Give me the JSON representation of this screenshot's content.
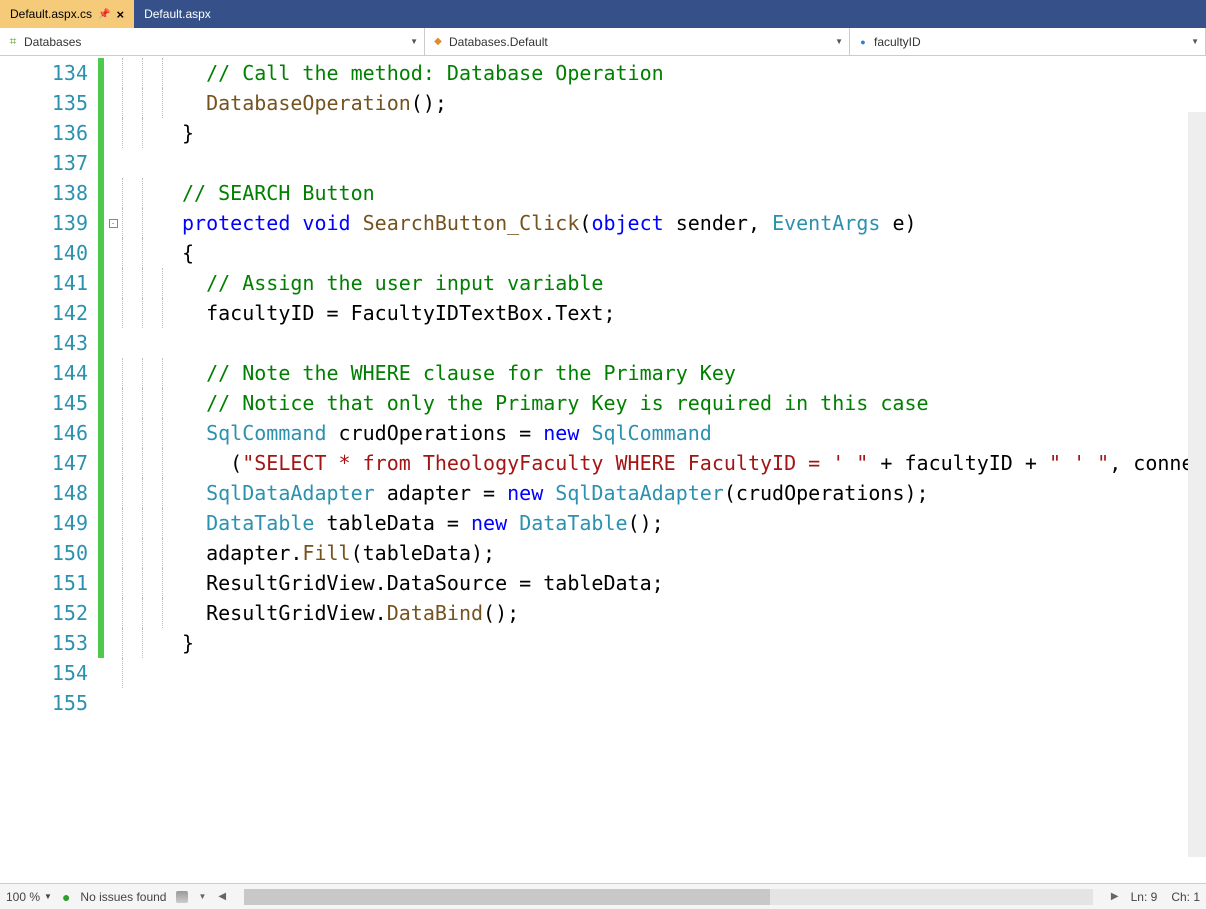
{
  "tabs": [
    {
      "label": "Default.aspx.cs",
      "active": true,
      "has_pin": true,
      "has_close": true
    },
    {
      "label": "Default.aspx",
      "active": false,
      "has_pin": false,
      "has_close": false
    }
  ],
  "crumbs": {
    "scope": "Databases",
    "class": "Databases.Default",
    "member": "facultyID"
  },
  "line_start": 134,
  "line_end": 155,
  "modified_lines_green_start": 134,
  "modified_lines_green_end": 153,
  "fold_line": 139,
  "code_lines": [
    {
      "n": 134,
      "indent": 3,
      "tokens": [
        {
          "t": "// Call the method: Database Operation",
          "c": "comment"
        }
      ]
    },
    {
      "n": 135,
      "indent": 3,
      "tokens": [
        {
          "t": "DatabaseOperation",
          "c": "method"
        },
        {
          "t": "();",
          "c": "text"
        }
      ]
    },
    {
      "n": 136,
      "indent": 2,
      "tokens": [
        {
          "t": "}",
          "c": "text"
        }
      ]
    },
    {
      "n": 137,
      "indent": 0,
      "tokens": []
    },
    {
      "n": 138,
      "indent": 2,
      "tokens": [
        {
          "t": "// SEARCH Button",
          "c": "comment"
        }
      ]
    },
    {
      "n": 139,
      "indent": 2,
      "tokens": [
        {
          "t": "protected",
          "c": "keyword"
        },
        {
          "t": " ",
          "c": "text"
        },
        {
          "t": "void",
          "c": "keyword"
        },
        {
          "t": " ",
          "c": "text"
        },
        {
          "t": "SearchButton_Click",
          "c": "method"
        },
        {
          "t": "(",
          "c": "text"
        },
        {
          "t": "object",
          "c": "keyword"
        },
        {
          "t": " sender, ",
          "c": "text"
        },
        {
          "t": "EventArgs",
          "c": "type"
        },
        {
          "t": " e)",
          "c": "text"
        }
      ]
    },
    {
      "n": 140,
      "indent": 2,
      "tokens": [
        {
          "t": "{",
          "c": "text"
        }
      ]
    },
    {
      "n": 141,
      "indent": 3,
      "tokens": [
        {
          "t": "// Assign the user input variable",
          "c": "comment"
        }
      ]
    },
    {
      "n": 142,
      "indent": 3,
      "tokens": [
        {
          "t": "facultyID = FacultyIDTextBox.Text;",
          "c": "text"
        }
      ]
    },
    {
      "n": 143,
      "indent": 0,
      "tokens": []
    },
    {
      "n": 144,
      "indent": 3,
      "tokens": [
        {
          "t": "// Note the WHERE clause for the Primary Key",
          "c": "comment"
        }
      ]
    },
    {
      "n": 145,
      "indent": 3,
      "tokens": [
        {
          "t": "// Notice that only the Primary Key is required in this case",
          "c": "comment"
        }
      ]
    },
    {
      "n": 146,
      "indent": 3,
      "tokens": [
        {
          "t": "SqlCommand",
          "c": "type"
        },
        {
          "t": " crudOperations = ",
          "c": "text"
        },
        {
          "t": "new",
          "c": "keyword"
        },
        {
          "t": " ",
          "c": "text"
        },
        {
          "t": "SqlCommand",
          "c": "type"
        }
      ]
    },
    {
      "n": 147,
      "indent": 4,
      "tokens": [
        {
          "t": "(",
          "c": "text"
        },
        {
          "t": "\"SELECT * from TheologyFaculty WHERE FacultyID = ' \"",
          "c": "string"
        },
        {
          "t": " + facultyID + ",
          "c": "text"
        },
        {
          "t": "\" ' \"",
          "c": "string"
        },
        {
          "t": ", connectDatabase);",
          "c": "text"
        }
      ]
    },
    {
      "n": 148,
      "indent": 3,
      "tokens": [
        {
          "t": "SqlDataAdapter",
          "c": "type"
        },
        {
          "t": " adapter = ",
          "c": "text"
        },
        {
          "t": "new",
          "c": "keyword"
        },
        {
          "t": " ",
          "c": "text"
        },
        {
          "t": "SqlDataAdapter",
          "c": "type"
        },
        {
          "t": "(crudOperations);",
          "c": "text"
        }
      ]
    },
    {
      "n": 149,
      "indent": 3,
      "tokens": [
        {
          "t": "DataTable",
          "c": "type"
        },
        {
          "t": " tableData = ",
          "c": "text"
        },
        {
          "t": "new",
          "c": "keyword"
        },
        {
          "t": " ",
          "c": "text"
        },
        {
          "t": "DataTable",
          "c": "type"
        },
        {
          "t": "();",
          "c": "text"
        }
      ]
    },
    {
      "n": 150,
      "indent": 3,
      "tokens": [
        {
          "t": "adapter.",
          "c": "text"
        },
        {
          "t": "Fill",
          "c": "method"
        },
        {
          "t": "(tableData);",
          "c": "text"
        }
      ]
    },
    {
      "n": 151,
      "indent": 3,
      "tokens": [
        {
          "t": "ResultGridView.DataSource = tableData;",
          "c": "text"
        }
      ]
    },
    {
      "n": 152,
      "indent": 3,
      "tokens": [
        {
          "t": "ResultGridView.",
          "c": "text"
        },
        {
          "t": "DataBind",
          "c": "method"
        },
        {
          "t": "();",
          "c": "text"
        }
      ]
    },
    {
      "n": 153,
      "indent": 2,
      "tokens": [
        {
          "t": "}",
          "c": "text"
        }
      ]
    },
    {
      "n": 154,
      "indent": 1,
      "tokens": [
        {
          "t": "}",
          "c": "text"
        }
      ]
    },
    {
      "n": 155,
      "indent": 0,
      "tokens": [
        {
          "t": "}",
          "c": "text"
        }
      ]
    }
  ],
  "status": {
    "zoom": "100 %",
    "issues": "No issues found",
    "line": "Ln: 9",
    "col": "Ch: 1"
  }
}
